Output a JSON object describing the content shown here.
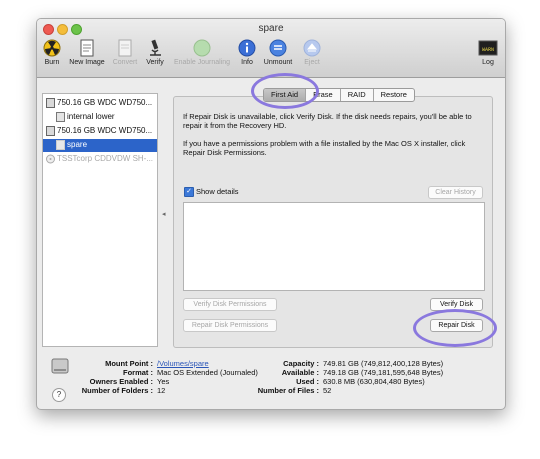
{
  "window": {
    "title": "spare"
  },
  "toolbar": {
    "burn": "Burn",
    "new_image": "New Image",
    "convert": "Convert",
    "verify": "Verify",
    "enable_journaling": "Enable Journaling",
    "info": "Info",
    "unmount": "Unmount",
    "eject": "Eject",
    "log": "Log",
    "log_icon_text": "WARN"
  },
  "sidebar": {
    "items": [
      {
        "label": "750.16 GB WDC WD750..."
      },
      {
        "label": "internal lower"
      },
      {
        "label": "750.16 GB WDC WD750..."
      },
      {
        "label": "spare"
      },
      {
        "label": "TSSTcorp CDDVDW SH-..."
      }
    ]
  },
  "tabs": [
    "First Aid",
    "Erase",
    "RAID",
    "Restore"
  ],
  "first_aid": {
    "para1": "If Repair Disk is unavailable, click Verify Disk. If the disk needs repairs, you'll be able to repair it from the Recovery HD.",
    "para2": "If you have a permissions problem with a file installed by the Mac OS X installer, click Repair Disk Permissions.",
    "show_details": "Show details",
    "clear_history": "Clear History",
    "verify_permissions": "Verify Disk Permissions",
    "repair_permissions": "Repair Disk Permissions",
    "verify_disk": "Verify Disk",
    "repair_disk": "Repair Disk"
  },
  "info": {
    "mount_point_label": "Mount Point :",
    "mount_point": "/Volumes/spare",
    "format_label": "Format :",
    "format": "Mac OS Extended (Journaled)",
    "owners_label": "Owners Enabled :",
    "owners": "Yes",
    "folders_label": "Number of Folders :",
    "folders": "12",
    "capacity_label": "Capacity :",
    "capacity": "749.81 GB (749,812,400,128 Bytes)",
    "available_label": "Available :",
    "available": "749.18 GB (749,181,595,648 Bytes)",
    "used_label": "Used :",
    "used": "630.8 MB (630,804,480 Bytes)",
    "files_label": "Number of Files :",
    "files": "52"
  },
  "help": "?",
  "colors": {
    "selection": "#2c64c9",
    "annotation": "#8a78de"
  }
}
